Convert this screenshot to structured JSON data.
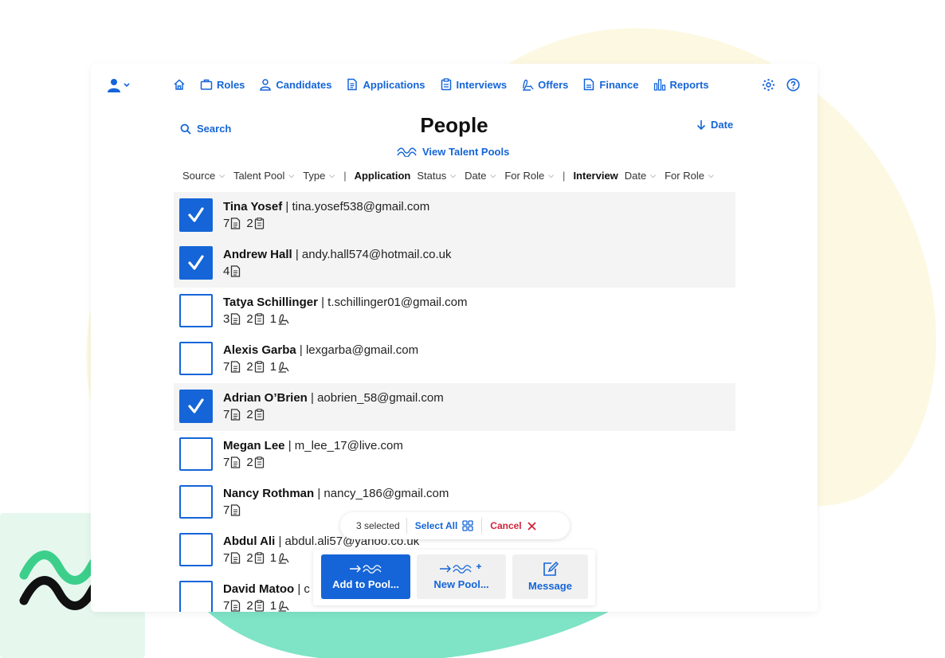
{
  "nav": {
    "items": [
      {
        "label": "Roles",
        "icon": "briefcase-icon"
      },
      {
        "label": "Candidates",
        "icon": "person-icon"
      },
      {
        "label": "Applications",
        "icon": "document-icon"
      },
      {
        "label": "Interviews",
        "icon": "clipboard-icon"
      },
      {
        "label": "Offers",
        "icon": "signature-icon"
      },
      {
        "label": "Finance",
        "icon": "ledger-icon"
      },
      {
        "label": "Reports",
        "icon": "bar-chart-icon"
      }
    ]
  },
  "header": {
    "title": "People",
    "search_label": "Search",
    "talent_pools_label": "View Talent Pools",
    "sort_label": "Date"
  },
  "filters": {
    "group1": [
      "Source",
      "Talent Pool",
      "Type"
    ],
    "application_heading": "Application",
    "group2": [
      "Status",
      "Date",
      "For Role"
    ],
    "interview_heading": "Interview",
    "group3": [
      "Date",
      "For Role"
    ]
  },
  "people": [
    {
      "name": "Tina Yosef",
      "email": "tina.yosef538@gmail.com",
      "selected": true,
      "applications": "7",
      "interviews": "2",
      "offers": null
    },
    {
      "name": "Andrew Hall",
      "email": "andy.hall574@hotmail.co.uk",
      "selected": true,
      "applications": "4",
      "interviews": null,
      "offers": null
    },
    {
      "name": "Tatya Schillinger",
      "email": "t.schillinger01@gmail.com",
      "selected": false,
      "applications": "3",
      "interviews": "2",
      "offers": "1"
    },
    {
      "name": "Alexis Garba",
      "email": "lexgarba@gmail.com",
      "selected": false,
      "applications": "7",
      "interviews": "2",
      "offers": "1"
    },
    {
      "name": "Adrian O’Brien",
      "email": "aobrien_58@gmail.com",
      "selected": true,
      "applications": "7",
      "interviews": "2",
      "offers": null
    },
    {
      "name": "Megan Lee",
      "email": "m_lee_17@live.com",
      "selected": false,
      "applications": "7",
      "interviews": "2",
      "offers": null
    },
    {
      "name": "Nancy Rothman",
      "email": "nancy_186@gmail.com",
      "selected": false,
      "applications": "7",
      "interviews": null,
      "offers": null
    },
    {
      "name": "Abdul Ali",
      "email": "abdul.ali57@yahoo.co.uk",
      "selected": false,
      "applications": "7",
      "interviews": "2",
      "offers": "1"
    },
    {
      "name": "David Matoo",
      "email": "c",
      "selected": false,
      "applications": "7",
      "interviews": "2",
      "offers": "1"
    }
  ],
  "selection": {
    "count_label": "3 selected",
    "select_all_label": "Select All",
    "cancel_label": "Cancel"
  },
  "actions": {
    "add_to_pool": "Add to Pool...",
    "new_pool": "New Pool...",
    "message": "Message"
  },
  "colors": {
    "accent": "#1565d8",
    "danger": "#d0223a",
    "blob_yellow": "#fdf8e1",
    "blob_teal": "#7fe3c6",
    "logo_green": "#3ccf8c"
  }
}
